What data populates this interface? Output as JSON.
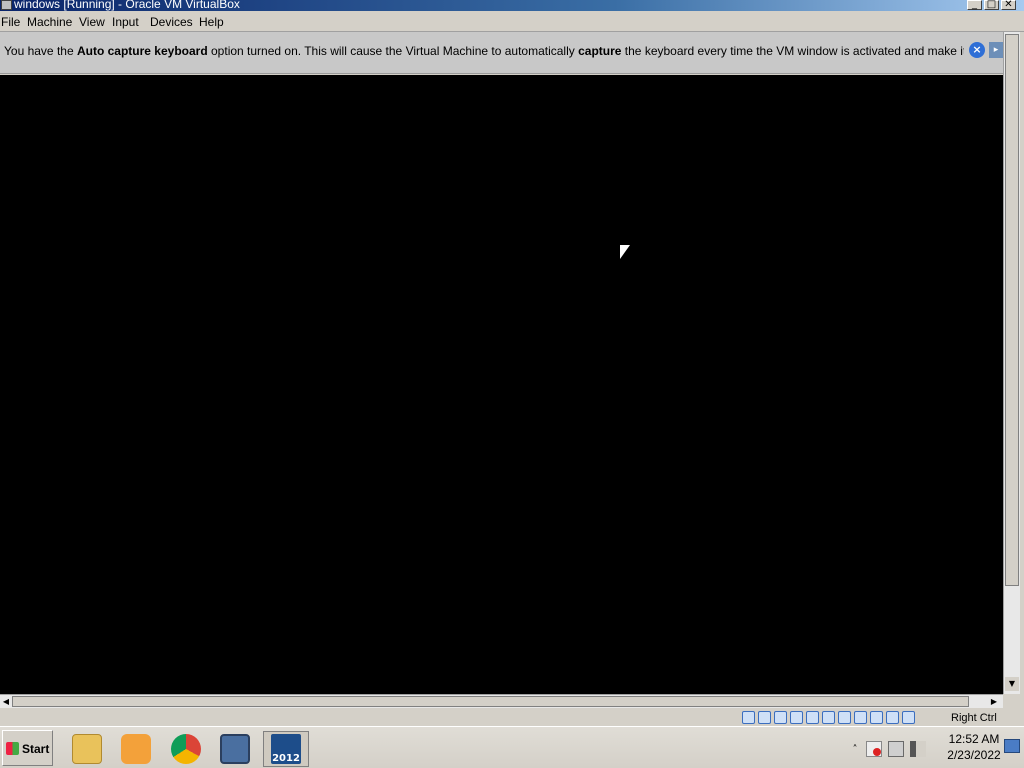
{
  "window": {
    "title": "windows [Running] - Oracle VM VirtualBox",
    "controls": {
      "minimize": "_",
      "maximize": "□",
      "close": "✕"
    }
  },
  "menu": [
    "File",
    "Machine",
    "View",
    "Input",
    "Devices",
    "Help"
  ],
  "notification": {
    "part1": "You have the ",
    "bold1": "Auto capture keyboard",
    "part2": " option turned on. This will cause the Virtual Machine to automatically ",
    "bold2": "capture",
    "part3": " the keyboard every time the VM window is activated and make it unavailable to",
    "close_icon": "close-circle-icon",
    "mouse_icon": "mouse-capture-icon"
  },
  "statusbar": {
    "host_key": "Right Ctrl",
    "icons": [
      "hard-disk-icon",
      "optical-drive-icon",
      "audio-icon",
      "network-icon",
      "usb-icon",
      "shared-folders-icon",
      "display-icon",
      "video-capture-icon",
      "virtualization-icon",
      "mouse-integration-icon",
      "keyboard-capture-icon"
    ]
  },
  "taskbar": {
    "start_label": "Start",
    "pinned": [
      "folder-explorer-icon",
      "media-player-icon",
      "chrome-icon",
      "virtualbox-icon",
      "windows-server-2012-icon"
    ],
    "vm_icon_label": "2012",
    "tray": {
      "chevron": "˄",
      "icons": [
        "action-center-icon",
        "network-icon",
        "volume-icon"
      ]
    },
    "clock": {
      "time": "12:52 AM",
      "date": "2/23/2022"
    }
  },
  "colors": {
    "vm_background": "#000000",
    "notice_background": "#c8c8c8",
    "title_gradient_start": "#0a246a"
  }
}
